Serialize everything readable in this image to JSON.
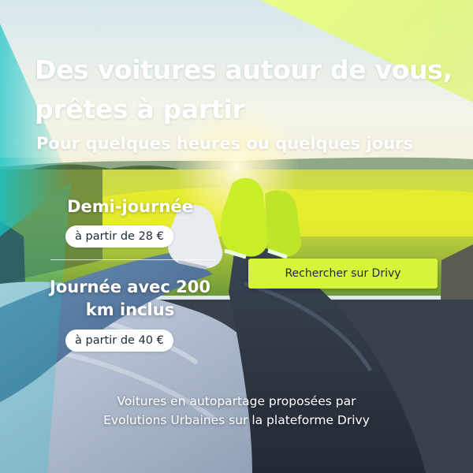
{
  "headline": {
    "line1": "Des voitures autour de vous,",
    "line2": "prêtes à partir"
  },
  "subheadline": "Pour quelques heures ou quelques jours",
  "offers": [
    {
      "title": "Demi-journée",
      "price": "à partir de 28 €"
    },
    {
      "title_line1": "Journée avec 200",
      "title_line2": "km inclus",
      "price": "à partir de 40 €"
    }
  ],
  "cta": {
    "label": "Rechercher sur Drivy"
  },
  "footer": {
    "line1": "Voitures en autopartage proposées par",
    "line2": "Evolutions Urbaines sur la plateforme Drivy"
  },
  "colors": {
    "accent_lime": "#d6f53a",
    "accent_teal": "#2fc9c4",
    "text_white": "#ffffff",
    "pill_bg": "#ffffff"
  },
  "icons": []
}
